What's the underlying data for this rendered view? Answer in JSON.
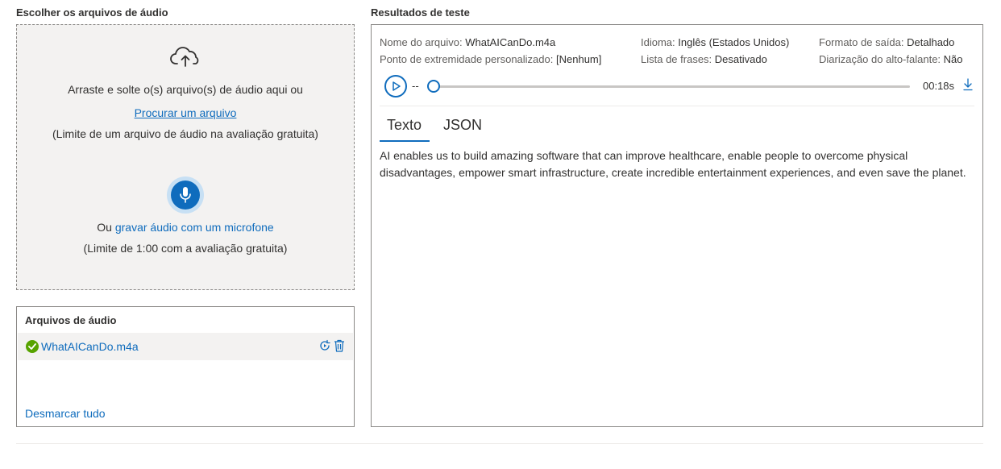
{
  "upload": {
    "title": "Escolher os arquivos de áudio",
    "drop_text": "Arraste e solte o(s) arquivo(s) de áudio aqui ou",
    "browse_link": "Procurar um arquivo",
    "file_limit": "(Limite de um arquivo de áudio na avaliação gratuita)",
    "record_prefix": "Ou ",
    "record_link": "gravar áudio com um microfone",
    "record_limit": "(Limite de 1:00 com a avaliação gratuita)",
    "icons": {
      "upload": "cloud-upload-icon",
      "record": "microphone-icon"
    }
  },
  "files": {
    "title": "Arquivos de áudio",
    "items": [
      {
        "name": "WhatAICanDo.m4a",
        "status_icon": "check-circle-icon",
        "status_color": "#57a300"
      }
    ],
    "clear_all": "Desmarcar tudo"
  },
  "results": {
    "title": "Resultados de teste",
    "meta": {
      "filename_label": "Nome do arquivo:",
      "filename_value": "WhatAICanDo.m4a",
      "endpoint_label": "Ponto de extremidade personalizado:",
      "endpoint_value": "[Nenhum]",
      "language_label": "Idioma:",
      "language_value": "Inglês (Estados Unidos)",
      "phrase_list_label": "Lista de frases:",
      "phrase_list_value": "Desativado",
      "output_format_label": "Formato de saída:",
      "output_format_value": "Detalhado",
      "diarization_label": "Diarização do alto-falante:",
      "diarization_value": "Não"
    },
    "player": {
      "elapsed": "--",
      "duration": "00:18s",
      "progress": 0
    },
    "tabs": [
      {
        "label": "Texto",
        "selected": true
      },
      {
        "label": "JSON",
        "selected": false
      }
    ],
    "transcript": "AI enables us to build amazing software that can improve healthcare, enable people to overcome physical disadvantages, empower smart infrastructure, create incredible entertainment experiences, and even save the planet."
  },
  "colors": {
    "accent": "#0f6cbd",
    "success": "#57a300",
    "dropzone_bg": "#f3f2f1"
  }
}
